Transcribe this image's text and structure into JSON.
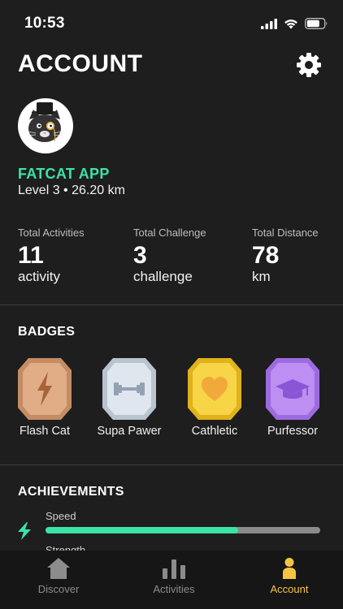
{
  "status_bar": {
    "time": "10:53"
  },
  "header": {
    "title": "ACCOUNT"
  },
  "profile": {
    "username": "FATCAT APP",
    "level_line": "Level 3 • 26.20 km"
  },
  "stats": [
    {
      "label": "Total Activities",
      "value": "11",
      "unit": "activity"
    },
    {
      "label": "Total Challenge",
      "value": "3",
      "unit": "challenge"
    },
    {
      "label": "Total Distance",
      "value": "78",
      "unit": "km"
    }
  ],
  "badges": {
    "title": "BADGES",
    "items": [
      {
        "name": "Flash Cat",
        "icon": "lightning-icon",
        "color": "#d9a07a"
      },
      {
        "name": "Supa Pawer",
        "icon": "dumbbell-icon",
        "color": "#dfe6ee"
      },
      {
        "name": "Cathletic",
        "icon": "heart-icon",
        "color": "#f5cf3b"
      },
      {
        "name": "Purfessor",
        "icon": "graduation-cap-icon",
        "color": "#b889f0"
      }
    ]
  },
  "achievements": {
    "title": "ACHIEVEMENTS",
    "items": [
      {
        "label": "Speed",
        "icon": "lightning-icon",
        "progress": 0.7
      },
      {
        "label": "Strength",
        "icon": "dumbbell-icon",
        "progress": null
      }
    ]
  },
  "tabs": [
    {
      "label": "Discover",
      "icon": "home-icon",
      "active": false
    },
    {
      "label": "Activities",
      "icon": "bar-chart-icon",
      "active": false
    },
    {
      "label": "Account",
      "icon": "person-icon",
      "active": true
    }
  ],
  "colors": {
    "accent": "#3de2a7",
    "active_tab": "#f5c542",
    "background": "#1e1e1e"
  }
}
